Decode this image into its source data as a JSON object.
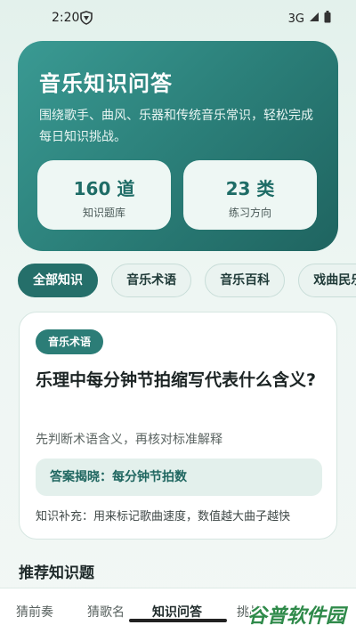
{
  "status_bar": {
    "time": "2:20",
    "network": "3G"
  },
  "hero": {
    "title": "音乐知识问答",
    "description": "围绕歌手、曲风、乐器和传统音乐常识，轻松完成每日知识挑战。",
    "stats": [
      {
        "value": "160 道",
        "label": "知识题库"
      },
      {
        "value": "23 类",
        "label": "练习方向"
      }
    ]
  },
  "categories": [
    {
      "label": "全部知识",
      "active": true
    },
    {
      "label": "音乐术语",
      "active": false
    },
    {
      "label": "音乐百科",
      "active": false
    },
    {
      "label": "戏曲民乐",
      "active": false
    }
  ],
  "question_card": {
    "tag": "音乐术语",
    "question": "乐理中每分钟节拍缩写代表什么含义?",
    "hint": "先判断术语含义，再核对标准解释",
    "answer": "答案揭晓：每分钟节拍数",
    "extra": "知识补充：用来标记歌曲速度，数值越大曲子越快"
  },
  "section": {
    "title": "推荐知识题"
  },
  "bottom_nav": [
    {
      "label": "猜前奏",
      "active": false
    },
    {
      "label": "猜歌名",
      "active": false
    },
    {
      "label": "知识问答",
      "active": true
    },
    {
      "label": "挑战",
      "active": false
    }
  ],
  "watermark": "谷普软件园",
  "colors": {
    "primary": "#256f6a",
    "hero_start": "#3a9a93",
    "hero_end": "#1f6460",
    "background": "#e3f1ec"
  }
}
